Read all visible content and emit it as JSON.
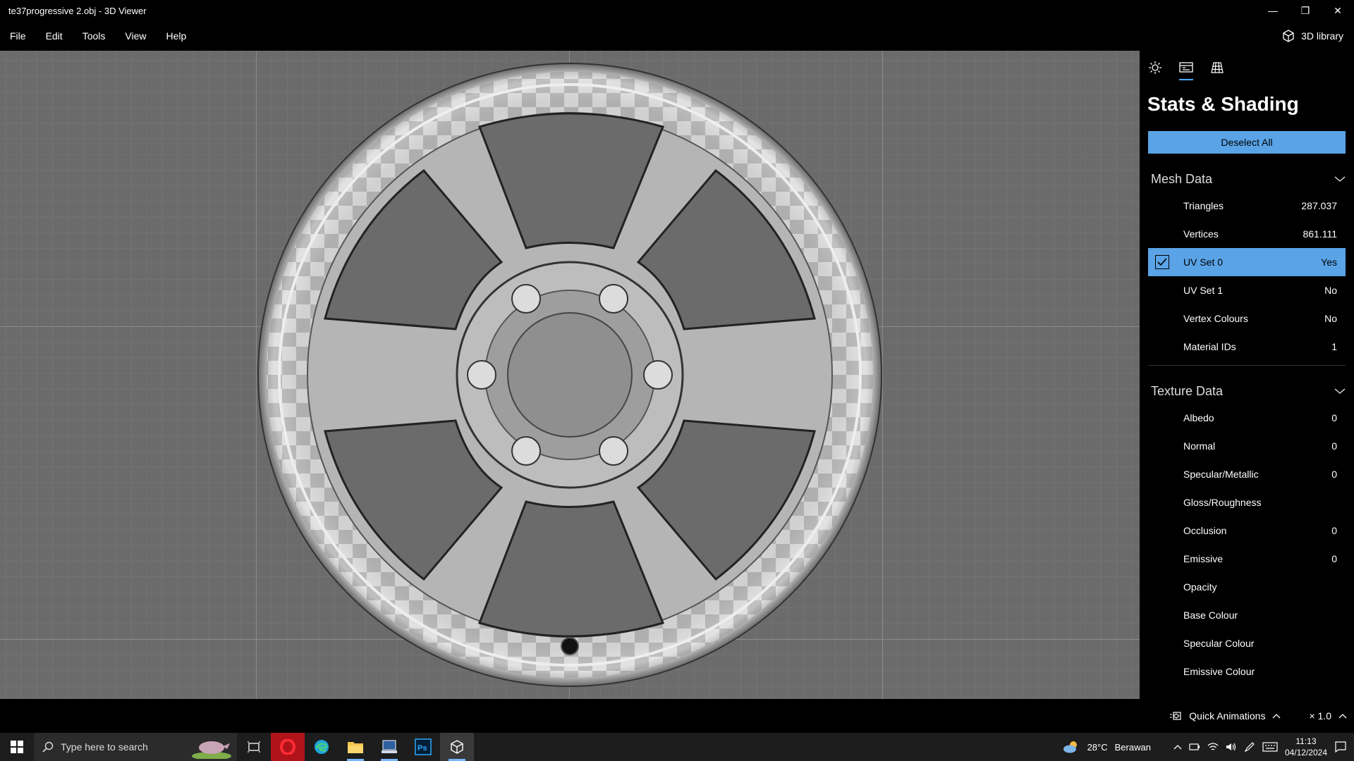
{
  "window": {
    "title": "te37progressive 2.obj - 3D Viewer",
    "minimize_glyph": "—",
    "restore_glyph": "❐",
    "close_glyph": "✕"
  },
  "menubar": {
    "items": [
      "File",
      "Edit",
      "Tools",
      "View",
      "Help"
    ],
    "library_label": "3D library"
  },
  "panel": {
    "tabs": [
      "lighting-icon",
      "stats-icon",
      "grid-icon"
    ],
    "active_tab": 1,
    "title": "Stats & Shading",
    "deselect_label": "Deselect All",
    "mesh_section": "Mesh Data",
    "mesh_rows": [
      {
        "label": "Triangles",
        "value": "287.037"
      },
      {
        "label": "Vertices",
        "value": "861.111"
      },
      {
        "label": "UV Set 0",
        "value": "Yes",
        "selected": true
      },
      {
        "label": "UV Set 1",
        "value": "No"
      },
      {
        "label": "Vertex Colours",
        "value": "No"
      },
      {
        "label": "Material IDs",
        "value": "1"
      }
    ],
    "texture_section": "Texture Data",
    "texture_rows": [
      {
        "label": "Albedo",
        "value": "0"
      },
      {
        "label": "Normal",
        "value": "0"
      },
      {
        "label": "Specular/Metallic",
        "value": "0"
      },
      {
        "label": "Gloss/Roughness",
        "value": ""
      },
      {
        "label": "Occlusion",
        "value": "0"
      },
      {
        "label": "Emissive",
        "value": "0"
      },
      {
        "label": "Opacity",
        "value": ""
      },
      {
        "label": "Base Colour",
        "value": ""
      },
      {
        "label": "Specular Colour",
        "value": ""
      },
      {
        "label": "Emissive Colour",
        "value": ""
      }
    ],
    "accent_color": "#5aa3e6"
  },
  "statusbar": {
    "quick_animations": "Quick Animations",
    "speed": "× 1.0"
  },
  "taskbar": {
    "search_placeholder": "Type here to search",
    "weather_temp": "28°C",
    "weather_desc": "Berawan",
    "time": "11:13",
    "date": "04/12/2024"
  }
}
